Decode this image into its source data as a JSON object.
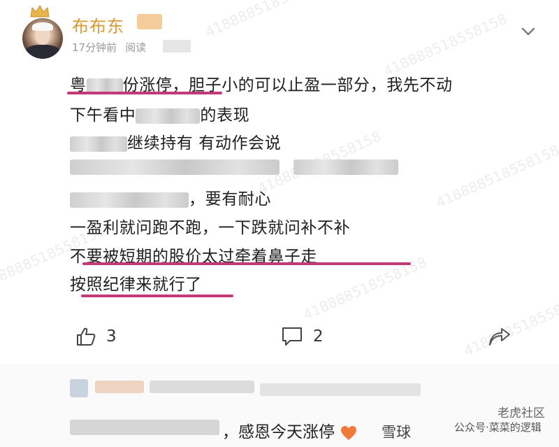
{
  "post": {
    "username": "布布东",
    "time": "17分钟前",
    "read_label": "阅读",
    "lines": {
      "l1_start": "粤",
      "l1_mid": "份涨停，胆子小的可以止盈一部分，我先不动",
      "l2_start": "下午看中",
      "l2_end": "的表现",
      "l3_end": "继续持有 有动作会说",
      "l5_end": "，要有耐心",
      "l6": "一盈利就问跑不跑，一下跌就问补不补",
      "l7": "不要被短期的股价太过牵着鼻子走",
      "l8": "按照纪律来就行了"
    },
    "like_count": "3",
    "comment_count": "2"
  },
  "comment": {
    "text": "，感恩今天涨停"
  },
  "watermark": {
    "text": "418888518558158"
  },
  "brand": {
    "logo1": "雪球",
    "logo2": "公众号·菜菜的逻辑",
    "logo3": "老虎社区"
  },
  "colors": {
    "username": "#d89a32",
    "underline": "#c43a78",
    "meta": "#9a9a9a"
  },
  "icons": [
    "crown-icon",
    "more-options-icon",
    "like-icon",
    "comment-icon",
    "share-icon",
    "heart-icon"
  ]
}
